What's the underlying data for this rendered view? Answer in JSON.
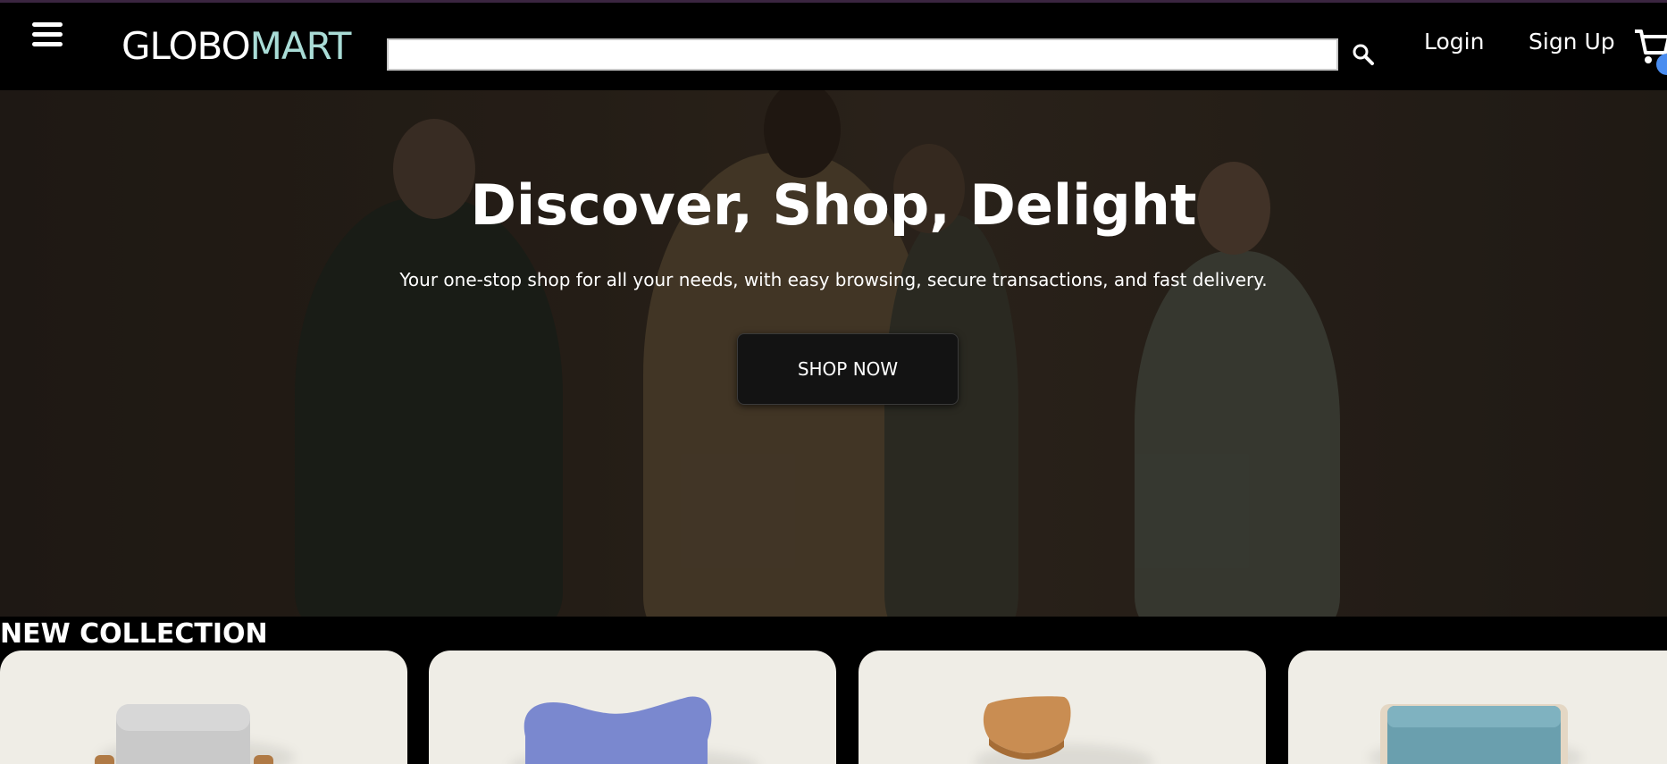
{
  "header": {
    "logo_part1": "GLOBO",
    "logo_part2": "MART",
    "search": {
      "value": "",
      "placeholder": ""
    },
    "login_label": "Login",
    "signup_label": "Sign Up",
    "icons": [
      "menu-icon",
      "search-icon",
      "cart-icon"
    ]
  },
  "hero": {
    "title": "Discover, Shop, Delight",
    "subtitle": "Your one-stop shop for all your needs, with easy browsing, secure transactions, and fast delivery.",
    "cta_label": "SHOP NOW"
  },
  "collection": {
    "title": "NEW COLLECTION",
    "products": [
      {
        "name": "grey armchair",
        "color": "#c9c9c9"
      },
      {
        "name": "blue lounge chair",
        "color": "#7a88cf"
      },
      {
        "name": "wooden chair",
        "color": "#c98d52"
      },
      {
        "name": "teal cushion",
        "color": "#6a9fae"
      }
    ]
  },
  "colors": {
    "logo_accent": "#a9dcd6",
    "background": "#000000",
    "card_background": "#efede6",
    "cart_badge": "#4a8df0"
  }
}
